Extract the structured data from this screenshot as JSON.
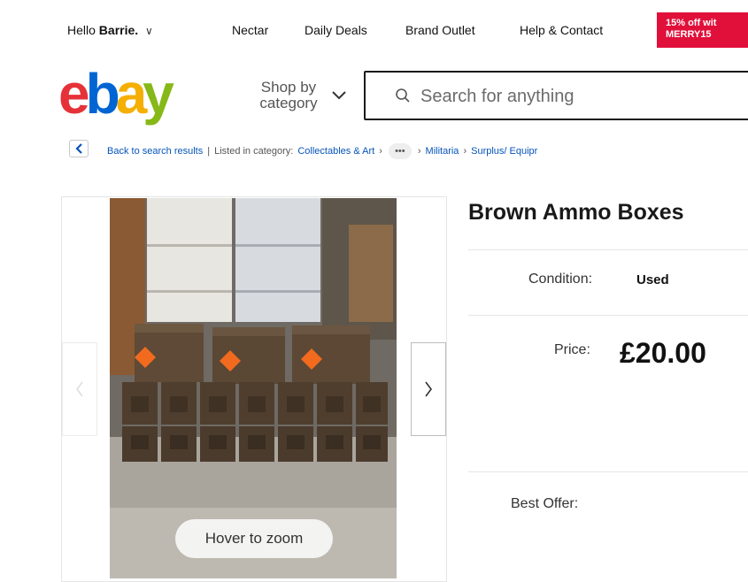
{
  "header": {
    "greeting_prefix": "Hello",
    "user_name": "Barrie.",
    "nav_links": [
      "Nectar",
      "Daily Deals",
      "Brand Outlet",
      "Help & Contact"
    ],
    "promo_line1": "15% off wit",
    "promo_line2": "MERRY15"
  },
  "logo_text": "ebay",
  "shop_by_category": "Shop by category",
  "shop_by_line1": "Shop by",
  "shop_by_line2": "category",
  "search": {
    "placeholder": "Search for anything"
  },
  "breadcrumb": {
    "back_label": "Back to search results",
    "listed_in": "Listed in category:",
    "items": [
      "Collectables & Art",
      "Militaria",
      "Surplus/ Equipr"
    ]
  },
  "gallery": {
    "zoom_hint": "Hover to zoom"
  },
  "item": {
    "title": "Brown Ammo Boxes",
    "condition_label": "Condition:",
    "condition_value": "Used",
    "price_label": "Price:",
    "price_value": "£20.00",
    "best_offer_label": "Best Offer:"
  },
  "colors": {
    "ebay_red": "#e53238",
    "ebay_blue": "#0064d2",
    "ebay_yellow": "#f5af02",
    "ebay_green": "#86b817",
    "promo_bg": "#e0103a",
    "link_blue": "#0654ba"
  }
}
